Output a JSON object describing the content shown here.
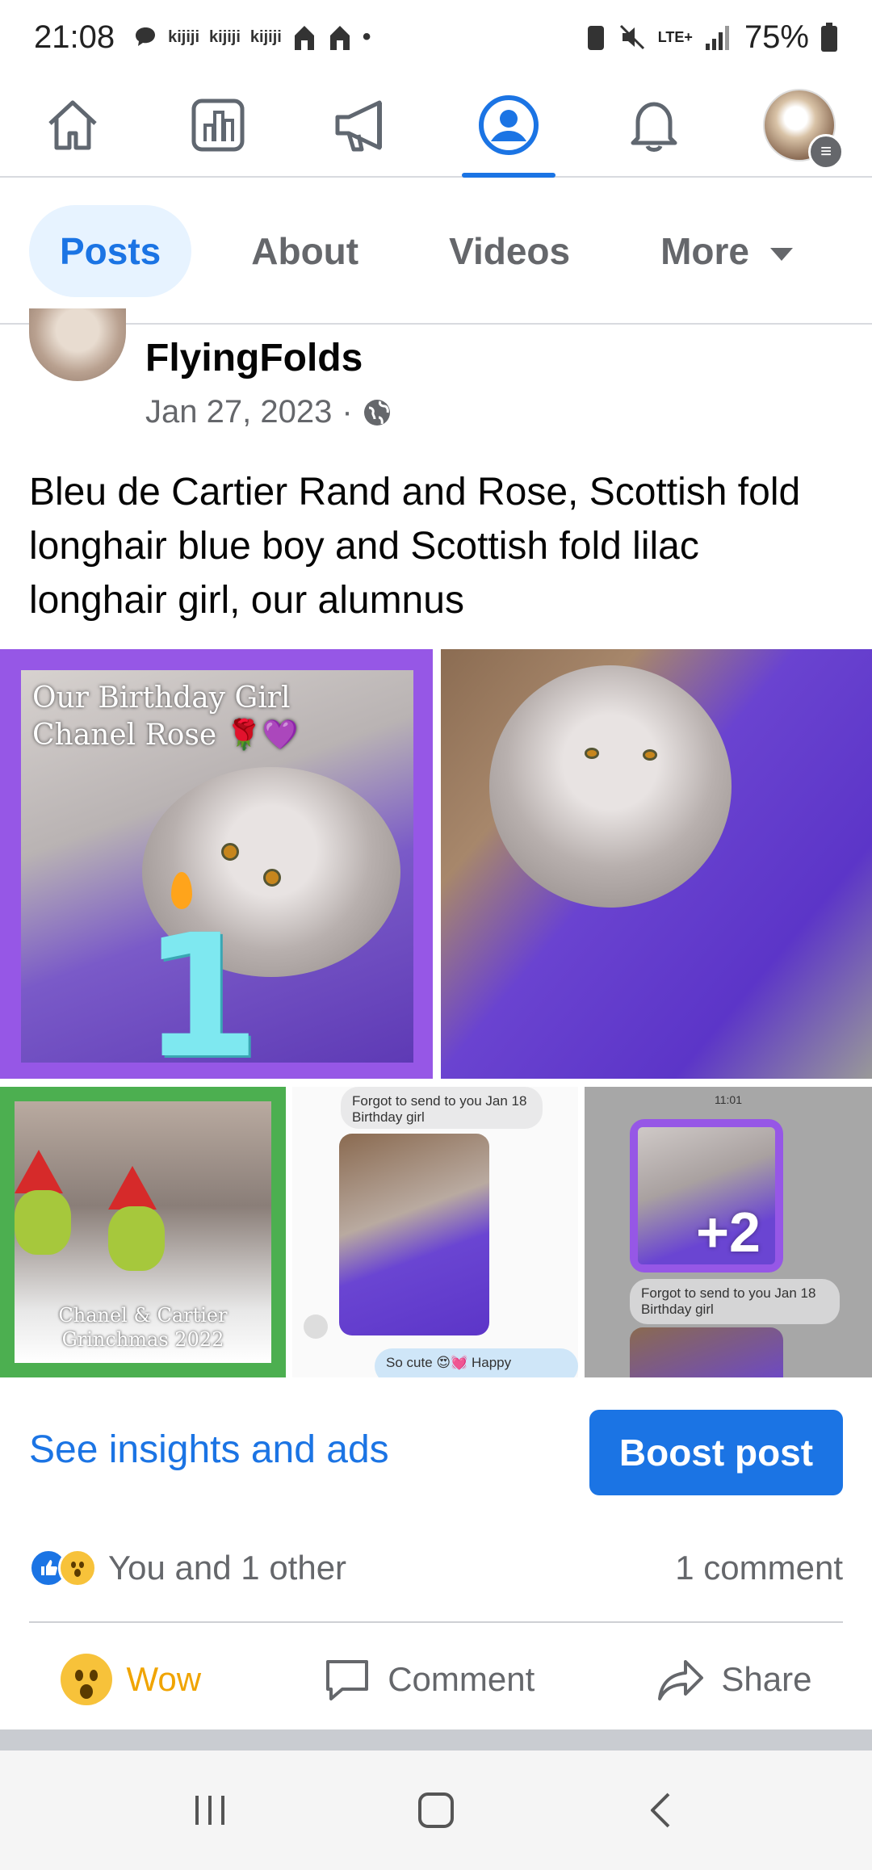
{
  "status_bar": {
    "time": "21:08",
    "notif_apps": [
      "kijiji",
      "kijiji",
      "kijiji"
    ],
    "network": "LTE+",
    "battery": "75%"
  },
  "top_nav": {
    "items": [
      "home-icon",
      "pages-icon",
      "megaphone-icon",
      "profile-icon",
      "bell-icon",
      "avatar-menu"
    ],
    "active": "profile-icon",
    "accent": "#1b74e4"
  },
  "tabs": {
    "items": [
      {
        "label": "Posts",
        "active": true
      },
      {
        "label": "About"
      },
      {
        "label": "Videos"
      },
      {
        "label": "More"
      }
    ]
  },
  "post": {
    "author": "FlyingFolds",
    "date": "Jan 27, 2023",
    "separator": "·",
    "text": "Bleu de Cartier Rand and Rose, Scottish fold longhair blue boy and Scottish fold lilac longhair girl, our alumnus",
    "photos": {
      "photo1": {
        "line1": "Our Birthday Girl",
        "line2": "Chanel Rose 🌹💜",
        "number": "1"
      },
      "photo3": {
        "line1": "Chanel & Cartier",
        "line2": "Grinchmas 2022"
      },
      "photo4": {
        "line1": "Forgot to send to you Jan 18",
        "line2": "Birthday girl",
        "reply": "So cute 😍💓 Happy"
      },
      "photo5": {
        "clock": "11:01",
        "line1": "Forgot to send to you Jan 18",
        "line2": "Birthday girl",
        "more": "+2"
      }
    }
  },
  "actions": {
    "insights": "See insights and ads",
    "boost": "Boost post",
    "reactions_text": "You and 1 other",
    "comments": "1 comment",
    "wow": "Wow",
    "comment": "Comment",
    "share": "Share"
  }
}
